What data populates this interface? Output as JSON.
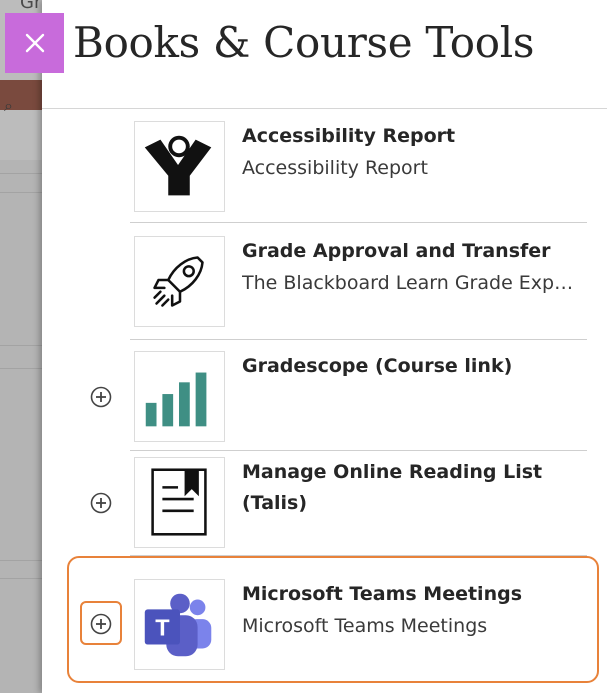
{
  "background": {
    "fragment_text": "Gr"
  },
  "panel": {
    "title": "Books & Course Tools",
    "close_label": "Close"
  },
  "items": [
    {
      "title": "Accessibility Report",
      "description": "Accessibility Report",
      "icon": "accessibility-report-icon",
      "has_add": false
    },
    {
      "title": "Grade Approval and Transfer",
      "description": "The Blackboard Learn Grade Exp…",
      "icon": "rocket-icon",
      "has_add": false
    },
    {
      "title": "Gradescope (Course link)",
      "description": "",
      "icon": "gradescope-bars-icon",
      "has_add": true
    },
    {
      "title": "Manage Online Reading List (Talis)",
      "description": "",
      "icon": "reading-list-icon",
      "has_add": true
    },
    {
      "title": "Microsoft Teams Meetings",
      "description": "Microsoft Teams Meetings",
      "icon": "microsoft-teams-icon",
      "has_add": true,
      "highlighted": true
    }
  ],
  "colors": {
    "close_button": "#c86bdb",
    "highlight": "#e8823a",
    "gradescope_teal": "#3f8f84",
    "teams_purple": "#5b5fc7"
  }
}
